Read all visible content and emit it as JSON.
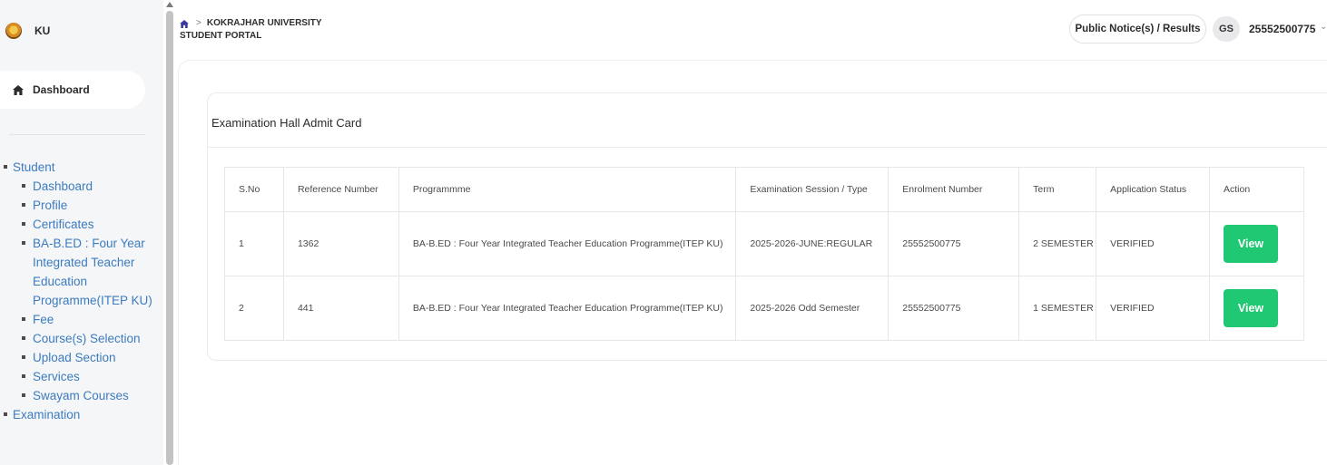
{
  "sidebar": {
    "brand": "KU",
    "dashboard_label": "Dashboard",
    "menu": {
      "student": {
        "label": "Student",
        "items": [
          "Dashboard",
          "Profile",
          "Certificates",
          "BA-B.ED : Four Year Integrated Teacher Education Programme(ITEP KU)",
          "Fee",
          "Course(s) Selection",
          "Upload Section",
          "Services",
          "Swayam Courses"
        ]
      },
      "examination": {
        "label": "Examination"
      }
    }
  },
  "header": {
    "breadcrumb_university": "KOKRAJHAR UNIVERSITY",
    "breadcrumb_sep": ">",
    "breadcrumb_portal": "STUDENT PORTAL",
    "notice_button": "Public Notice(s) / Results",
    "user_initials": "GS",
    "user_id": "25552500775",
    "user_chevron": "⌄"
  },
  "card": {
    "title": "Examination Hall Admit Card",
    "table": {
      "headers": [
        "S.No",
        "Reference Number",
        "Programmme",
        "Examination Session / Type",
        "Enrolment Number",
        "Term",
        "Application Status",
        "Action"
      ],
      "rows": [
        {
          "sno": "1",
          "ref": "1362",
          "programme": "BA-B.ED : Four Year Integrated Teacher Education Programme(ITEP KU)",
          "session": "2025-2026-JUNE:REGULAR",
          "enrolment": "25552500775",
          "term": "2 SEMESTER",
          "status": "VERIFIED",
          "action": "View"
        },
        {
          "sno": "2",
          "ref": "441",
          "programme": "BA-B.ED : Four Year Integrated Teacher Education Programme(ITEP KU)",
          "session": "2025-2026 Odd Semester",
          "enrolment": "25552500775",
          "term": "1 SEMESTER",
          "status": "VERIFIED",
          "action": "View"
        }
      ]
    }
  },
  "colors": {
    "accent_green": "#21c873",
    "link_blue": "#3c7bbf",
    "sidebar_bg": "#f5f6f8"
  },
  "icons": {
    "dashboard": "home-icon",
    "breadcrumb": "home-icon",
    "brand": "university-logo-icon"
  }
}
